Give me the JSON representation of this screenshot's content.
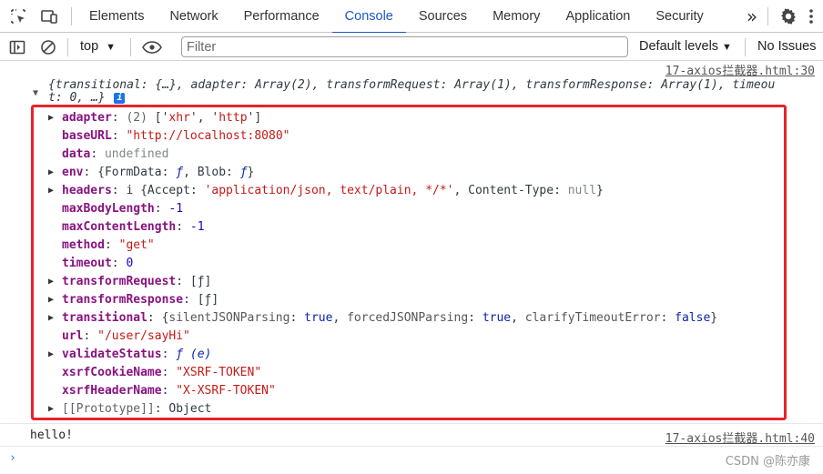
{
  "tabbar": {
    "tabs": [
      "Elements",
      "Network",
      "Performance",
      "Console",
      "Sources",
      "Memory",
      "Application",
      "Security"
    ],
    "active_tab": "Console",
    "more_label": "»",
    "icons": [
      "inspect-element-icon",
      "device-toolbar-icon",
      "more-tabs-icon",
      "settings-icon",
      "kebab-menu-icon"
    ]
  },
  "toolbar": {
    "context": "top",
    "filter_placeholder": "Filter",
    "levels": "Default levels",
    "issues": "No Issues"
  },
  "console": {
    "entry1": {
      "source": "17-axios拦截器.html:30",
      "summary_line1": "{transitional: {…}, adapter: Array(2), transformRequest: Array(1), transformResponse: Array(1), timeou",
      "summary_line2": "t: 0, …}"
    },
    "props": {
      "adapter_key": "adapter",
      "adapter_count": "(2)",
      "adapter_open": "['",
      "adapter_v1": "xhr",
      "adapter_mid": "', '",
      "adapter_v2": "http",
      "adapter_close": "']",
      "baseURL_key": "baseURL",
      "baseURL_val": "\"http://localhost:8080\"",
      "data_key": "data",
      "data_val": "undefined",
      "env_key": "env",
      "env_val_open": "{FormData: ",
      "env_f1": "ƒ",
      "env_mid": ", Blob: ",
      "env_f2": "ƒ",
      "env_close": "}",
      "headers_key": "headers",
      "headers_i": "i",
      "headers_open": "{Accept: ",
      "headers_accept": "'application/json, text/plain, */*'",
      "headers_ct": ", Content-Type: ",
      "headers_null": "null",
      "headers_close": "}",
      "maxBodyLength_key": "maxBodyLength",
      "maxBodyLength_val": "-1",
      "maxContentLength_key": "maxContentLength",
      "maxContentLength_val": "-1",
      "method_key": "method",
      "method_val": "\"get\"",
      "timeout_key": "timeout",
      "timeout_val": "0",
      "transformRequest_key": "transformRequest",
      "transformRequest_val": "[ƒ]",
      "transformResponse_key": "transformResponse",
      "transformResponse_val": "[ƒ]",
      "transitional_key": "transitional",
      "tr_k1": "silentJSONParsing",
      "tr_v1": "true",
      "tr_k2": "forcedJSONParsing",
      "tr_v2": "true",
      "tr_k3": "clarifyTimeoutError",
      "tr_v3": "false",
      "url_key": "url",
      "url_val": "\"/user/sayHi\"",
      "validateStatus_key": "validateStatus",
      "validateStatus_val": "ƒ (e)",
      "xsrfCookieName_key": "xsrfCookieName",
      "xsrfCookieName_val": "\"XSRF-TOKEN\"",
      "xsrfHeaderName_key": "xsrfHeaderName",
      "xsrfHeaderName_val": "\"X-XSRF-TOKEN\"",
      "prototype_key": "[[Prototype]]",
      "prototype_val": "Object"
    },
    "entry2": {
      "text": "hello!",
      "source": "17-axios拦截器.html:40"
    },
    "prompt": "›"
  },
  "watermark": "CSDN @陈亦康",
  "colors": {
    "accent": "#1a56c8",
    "highlight_box": "#e8232b",
    "key": "#881280",
    "string": "#c41a16",
    "number": "#1c00cf"
  }
}
